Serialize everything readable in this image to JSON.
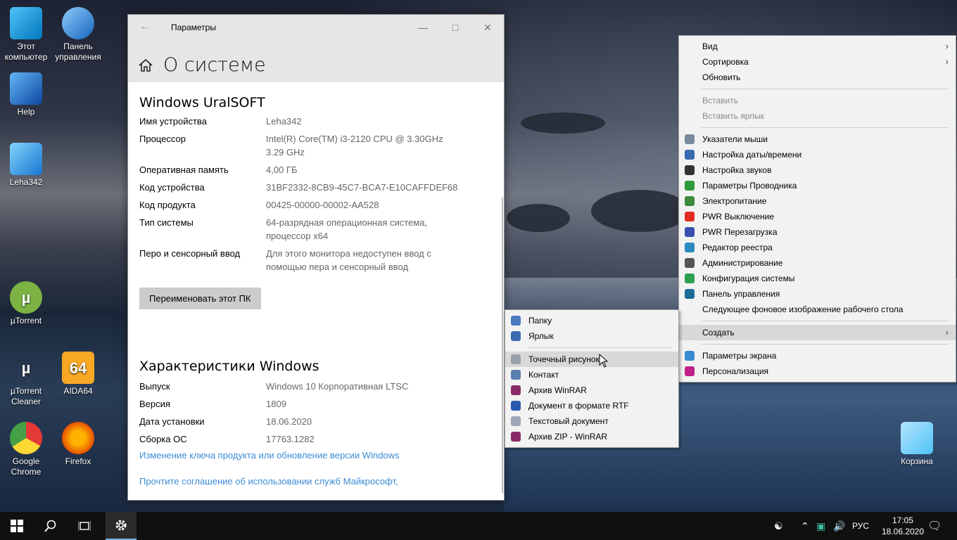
{
  "desktop_icons": [
    {
      "label": "Этот компьютер",
      "icon": "computer-icon"
    },
    {
      "label": "Панель управления",
      "icon": "control-panel-icon"
    },
    {
      "label": "Help",
      "icon": "help-icon"
    },
    {
      "label": "Leha342",
      "icon": "user-folder-icon"
    },
    {
      "label": "µTorrent",
      "icon": "utorrent-icon"
    },
    {
      "label": "µTorrent Cleaner",
      "icon": "utorrent-cleaner-icon"
    },
    {
      "label": "AIDA64",
      "icon": "aida64-icon"
    },
    {
      "label": "Google Chrome",
      "icon": "chrome-icon"
    },
    {
      "label": "Firefox",
      "icon": "firefox-icon"
    },
    {
      "label": "Корзина",
      "icon": "recycle-bin-icon"
    }
  ],
  "settings": {
    "window_title": "Параметры",
    "page_title": "О системе",
    "device_section": "Windows UralSOFT",
    "device_rows": [
      {
        "k": "Имя устройства",
        "v": "Leha342"
      },
      {
        "k": "Процессор",
        "v": "Intel(R) Core(TM) i3-2120 CPU @ 3.30GHz 3.29 GHz"
      },
      {
        "k": "Оперативная память",
        "v": "4,00 ГБ"
      },
      {
        "k": "Код устройства",
        "v": "31BF2332-8CB9-45C7-BCA7-E10CAFFDEF68"
      },
      {
        "k": "Код продукта",
        "v": "00425-00000-00002-AA528"
      },
      {
        "k": "Тип системы",
        "v": "64-разрядная операционная система, процессор x64"
      },
      {
        "k": "Перо и сенсорный ввод",
        "v": "Для этого монитора недоступен ввод с помощью пера и сенсорный ввод"
      }
    ],
    "rename_button": "Переименовать этот ПК",
    "windows_section": "Характеристики Windows",
    "windows_rows": [
      {
        "k": "Выпуск",
        "v": "Windows 10 Корпоративная LTSC"
      },
      {
        "k": "Версия",
        "v": "1809"
      },
      {
        "k": "Дата установки",
        "v": "18.06.2020"
      },
      {
        "k": "Сборка ОС",
        "v": "17763.1282"
      }
    ],
    "link_change_key": "Изменение ключа продукта или обновление версии Windows",
    "link_agreement": "Прочтите соглашение об использовании служб Майкрософт,"
  },
  "context_menu": {
    "items": [
      {
        "label": "Вид",
        "submenu": true
      },
      {
        "label": "Сортировка",
        "submenu": true
      },
      {
        "label": "Обновить"
      },
      {
        "sep": true
      },
      {
        "label": "Вставить",
        "disabled": true
      },
      {
        "label": "Вставить ярлык",
        "disabled": true
      },
      {
        "sep": true
      },
      {
        "label": "Указатели мыши",
        "icon": "mouse-pointer-icon",
        "color": "#7a8aa0"
      },
      {
        "label": "Настройка даты/времени",
        "icon": "calendar-clock-icon",
        "color": "#3a6ab0"
      },
      {
        "label": "Настройка звуков",
        "icon": "speaker-icon",
        "color": "#333333"
      },
      {
        "label": "Параметры Проводника",
        "icon": "folder-options-icon",
        "color": "#2f9a3a"
      },
      {
        "label": "Электропитание",
        "icon": "power-plan-icon",
        "color": "#3d8a3d"
      },
      {
        "label": "PWR Выключение",
        "icon": "power-off-icon",
        "color": "#e02b20"
      },
      {
        "label": "PWR Перезагрузка",
        "icon": "restart-icon",
        "color": "#3a4fb0"
      },
      {
        "label": "Редактор реестра",
        "icon": "registry-icon",
        "color": "#2a8ac0"
      },
      {
        "label": "Администрирование",
        "icon": "admin-tools-icon",
        "color": "#555555"
      },
      {
        "label": "Конфигурация системы",
        "icon": "msconfig-icon",
        "color": "#2aa050"
      },
      {
        "label": "Панель управления",
        "icon": "control-panel-icon",
        "color": "#1a6a9a"
      },
      {
        "label": "Следующее фоновое изображение рабочего стола"
      },
      {
        "sep": true
      },
      {
        "label": "Создать",
        "submenu": true,
        "highlighted": true
      },
      {
        "sep": true
      },
      {
        "label": "Параметры экрана",
        "icon": "display-icon",
        "color": "#3a8ad0"
      },
      {
        "label": "Персонализация",
        "icon": "personalization-icon",
        "color": "#c0208a"
      }
    ]
  },
  "create_submenu": {
    "items": [
      {
        "label": "Папку",
        "icon": "folder-icon",
        "color": "#4a7ac0"
      },
      {
        "label": "Ярлык",
        "icon": "shortcut-icon",
        "color": "#3a6ab0"
      },
      {
        "sep": true
      },
      {
        "label": "Точечный рисунок",
        "icon": "bitmap-icon",
        "color": "#9aa0aa",
        "highlighted": true
      },
      {
        "label": "Контакт",
        "icon": "contact-icon",
        "color": "#5a80b0"
      },
      {
        "label": "Архив WinRAR",
        "icon": "winrar-icon",
        "color": "#8a2a6a"
      },
      {
        "label": "Документ в формате RTF",
        "icon": "rtf-icon",
        "color": "#2a5ab0"
      },
      {
        "label": "Текстовый документ",
        "icon": "text-doc-icon",
        "color": "#a0a8b8"
      },
      {
        "label": "Архив ZIP - WinRAR",
        "icon": "zip-icon",
        "color": "#8a2a6a"
      }
    ]
  },
  "taskbar": {
    "language": "РУС",
    "time": "17:05",
    "date": "18.06.2020"
  }
}
